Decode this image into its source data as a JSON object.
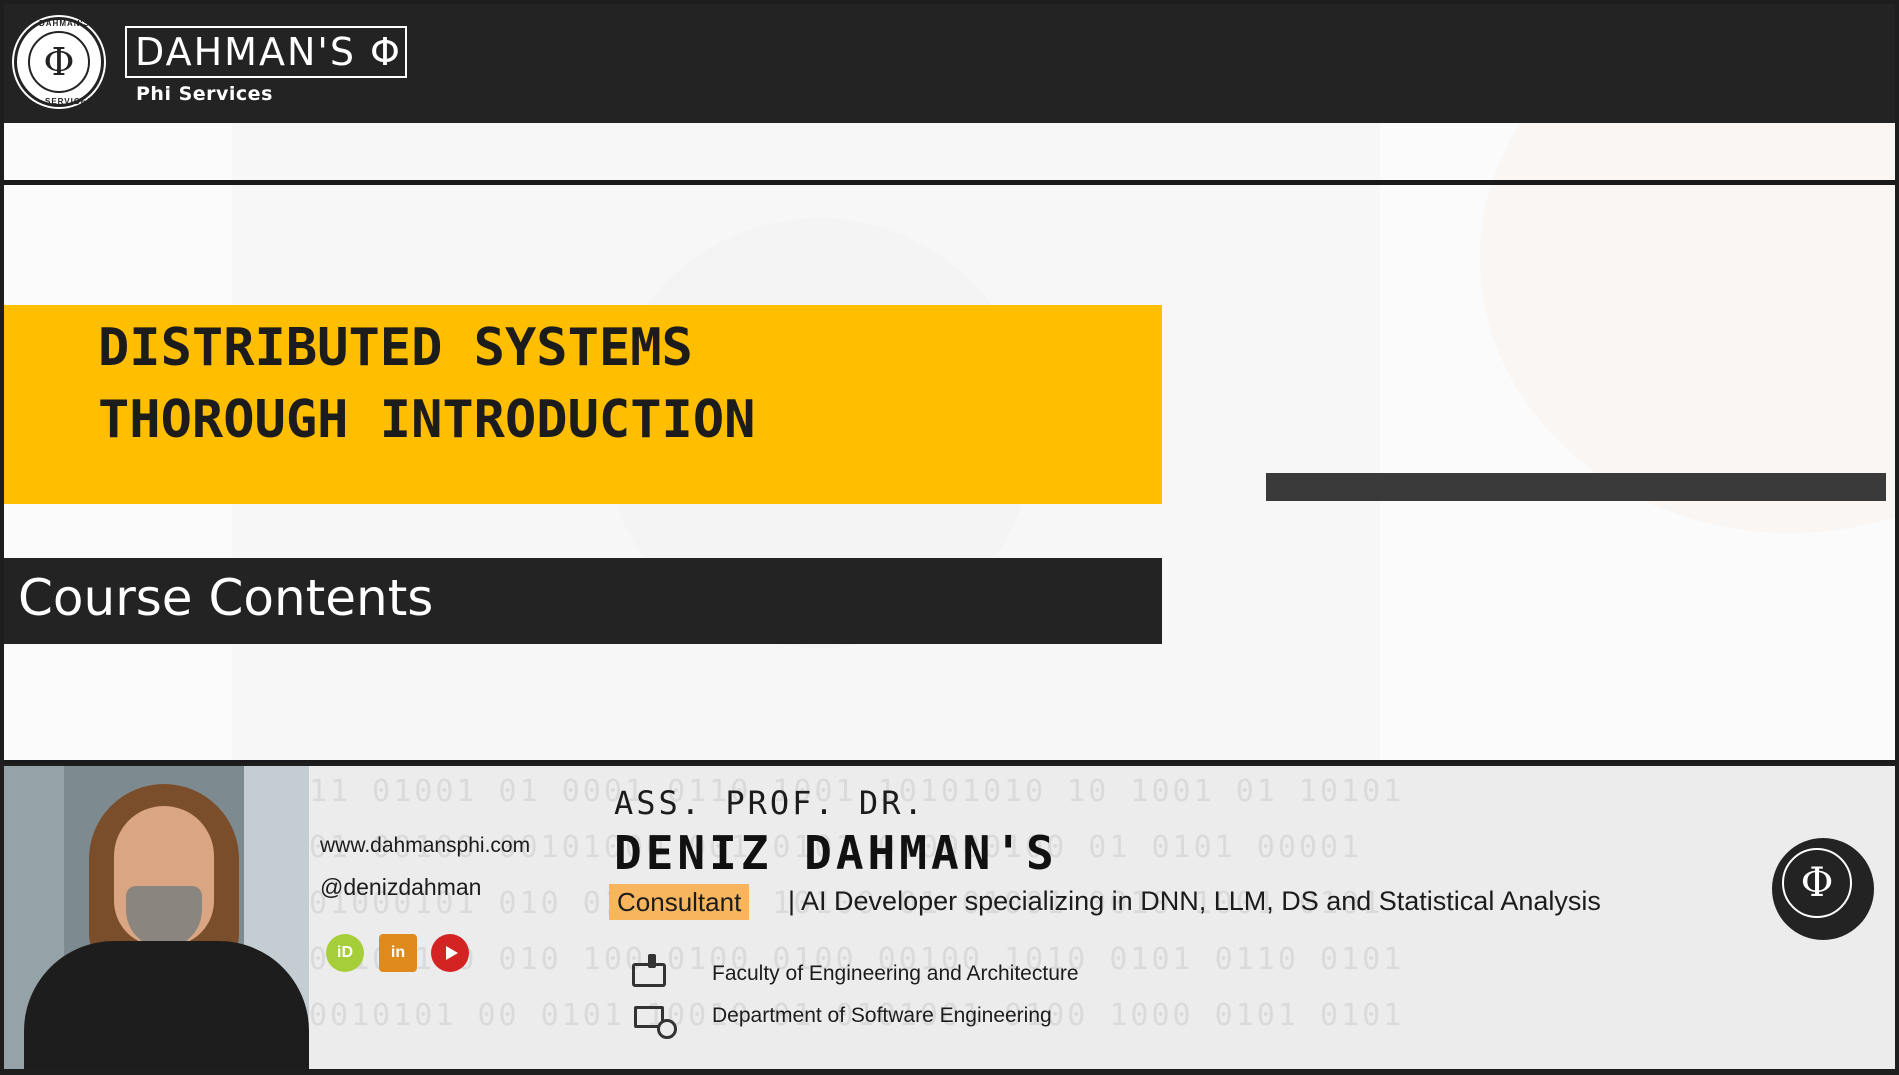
{
  "header": {
    "logo_symbol": "Φ",
    "logo_ring_top": "DAHMAN'S",
    "logo_ring_bottom": "SERVICES",
    "brand_title": "DAHMAN'S Φ",
    "brand_subtitle": "Phi Services"
  },
  "slide": {
    "title_line1": "DISTRIBUTED SYSTEMS",
    "title_line2": "THOROUGH INTRODUCTION",
    "section_label": "Course Contents"
  },
  "footer": {
    "website": "www.dahmansphi.com",
    "handle": "@denizdahman",
    "social_icons": [
      "orcid-icon",
      "linkedin-icon",
      "youtube-icon"
    ],
    "orcid_label": "iD",
    "linkedin_label": "in",
    "title_prefix": "ASS. PROF. DR.",
    "name": "DENIZ DAHMAN'S",
    "highlight": "Consultant",
    "role": "| AI Developer specializing in DNN, LLM, DS and Statistical Analysis",
    "faculty": "Faculty of Engineering and Architecture",
    "department": "Department of Software Engineering",
    "badge_symbol": "Φ",
    "binary_rows": [
      "11 01001 01 0001 0110 1001 10101010 10 1001 01 10101",
      "01 00100 00101000 001 0101 010000100 01 0101 00001",
      "01000101 010 01 10001 10100 01 01001 0010 1001 0101",
      "00100100 010 100 0100 0100 00100 1010 0101 0110 0101",
      "0010101 00 0101 10010 01 0101001 0100 1000 0101 0101"
    ]
  },
  "colors": {
    "accent_yellow": "#ffbe00",
    "highlight_orange": "#f7b55e",
    "dark": "#232323"
  }
}
